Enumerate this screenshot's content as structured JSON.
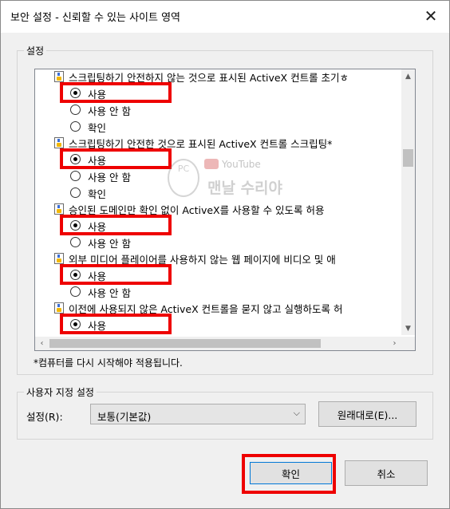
{
  "window": {
    "title": "보안 설정 - 신뢰할 수 있는 사이트 영역",
    "close_glyph": "✕"
  },
  "settings_group": {
    "label": "설정",
    "items": [
      {
        "text": "스크립팅하기 안전하지 않는 것으로 표시된 ActiveX 컨트롤 초기ㅎ",
        "options": [
          "사용",
          "사용 안 함",
          "확인"
        ],
        "selected": "사용"
      },
      {
        "text": "스크립팅하기 안전한 것으로 표시된 ActiveX 컨트롤 스크립팅*",
        "options": [
          "사용",
          "사용 안 함",
          "확인"
        ],
        "selected": "사용"
      },
      {
        "text": "승인된 도메인만 확인 없이 ActiveX를 사용할 수 있도록 허용",
        "options": [
          "사용",
          "사용 안 함"
        ],
        "selected": "사용"
      },
      {
        "text": "외부 미디어 플레이어를 사용하지 않는 웹 페이지에 비디오 및 애",
        "options": [
          "사용",
          "사용 안 함"
        ],
        "selected": "사용"
      },
      {
        "text": "이전에 사용되지 않은 ActiveX 컨트롤을 묻지 않고 실행하도록 허",
        "options": [
          "사용"
        ],
        "selected": "사용"
      }
    ],
    "note": "*컴퓨터를 다시 시작해야 적용됩니다."
  },
  "watermark": {
    "pc": "PC",
    "youtube": "YouTube",
    "main": "맨날 수리야"
  },
  "custom_group": {
    "label": "사용자 지정 설정",
    "reset_label": "설정(R):",
    "combo_value": "보통(기본값)",
    "reset_button": "원래대로(E)..."
  },
  "buttons": {
    "ok": "확인",
    "cancel": "취소"
  },
  "colors": {
    "highlight": "#ee0000",
    "accent": "#0078d7"
  }
}
